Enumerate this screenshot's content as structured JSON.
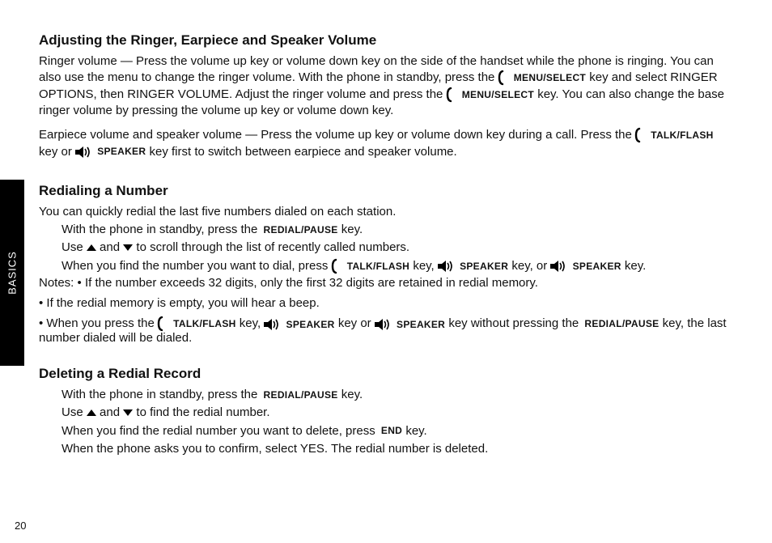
{
  "page": {
    "side_tab": "BASICS",
    "page_number": "20"
  },
  "heading_call_options": "Adjusting the Ringer, Earpiece and Speaker Volume",
  "ringer_vol": {
    "p1_a": "Ringer volume — Press the volume up key or volume down key on the side of the handset while the phone is ringing. You can also use the menu to change the ringer volume. With the phone in standby, press the",
    "keys": {
      "menu": "MENU/SELECT"
    },
    "p1_b": "key and select RINGER OPTIONS, then RINGER VOLUME. Adjust the ringer volume and press the",
    "p1_c": "key. You can also change the base ringer volume by pressing the volume up key or volume down key."
  },
  "earpiece_speaker": {
    "p1_a": "Earpiece volume and speaker volume — Press the volume up key or volume down key during a call. Press the",
    "keys": {
      "talk_flash": "TALK/FLASH",
      "speaker": "SPEAKER"
    },
    "p1_b": "key or",
    "p1_c": "key first to switch between earpiece and speaker volume."
  },
  "heading_redial": "Redialing a Number",
  "redial_intro": "You can quickly redial the last five numbers dialed on each station.",
  "redial_steps": {
    "s1_a": "With the phone in standby, press the",
    "keys": {
      "redial_pause": "REDIAL/PAUSE",
      "talk_flash": "TALK/FLASH",
      "speaker": "SPEAKER"
    },
    "s1_b": "key.",
    "s2_a": "Use",
    "s2_b": "and",
    "s2_c": "to scroll through the list of recently called numbers.",
    "s3_a": "When you find the number you want to dial, press",
    "s3_b": "key,",
    "s3_c": "key, or",
    "s3_d": "key."
  },
  "notes": {
    "label": "Notes:",
    "n1": "• If the number exceeds 32 digits, only the first 32 digits are retained in redial memory.",
    "n2_a": "• If the redial memory is empty, you will hear a beep.",
    "n3_a": "• When you press the",
    "n3_b": "key,",
    "n3_c": "key or",
    "n3_d": "key without pressing the",
    "n3_e": "key, the last number dialed will be dialed."
  },
  "heading_delete": "Deleting a Redial Record",
  "delete_steps": {
    "s1_a": "With the phone in standby, press the",
    "keys": {
      "redial_pause": "REDIAL/PAUSE",
      "end": "END"
    },
    "s1_b": "key.",
    "s2_a": "Use",
    "s2_b": "and",
    "s2_c": "to find the redial number.",
    "s3": "When you find the redial number you want to delete, press",
    "s3_b": "key.",
    "s4": "When the phone asks you to confirm, select YES. The redial number is deleted."
  },
  "selector_keys": {
    "up": "up",
    "down": "down"
  }
}
